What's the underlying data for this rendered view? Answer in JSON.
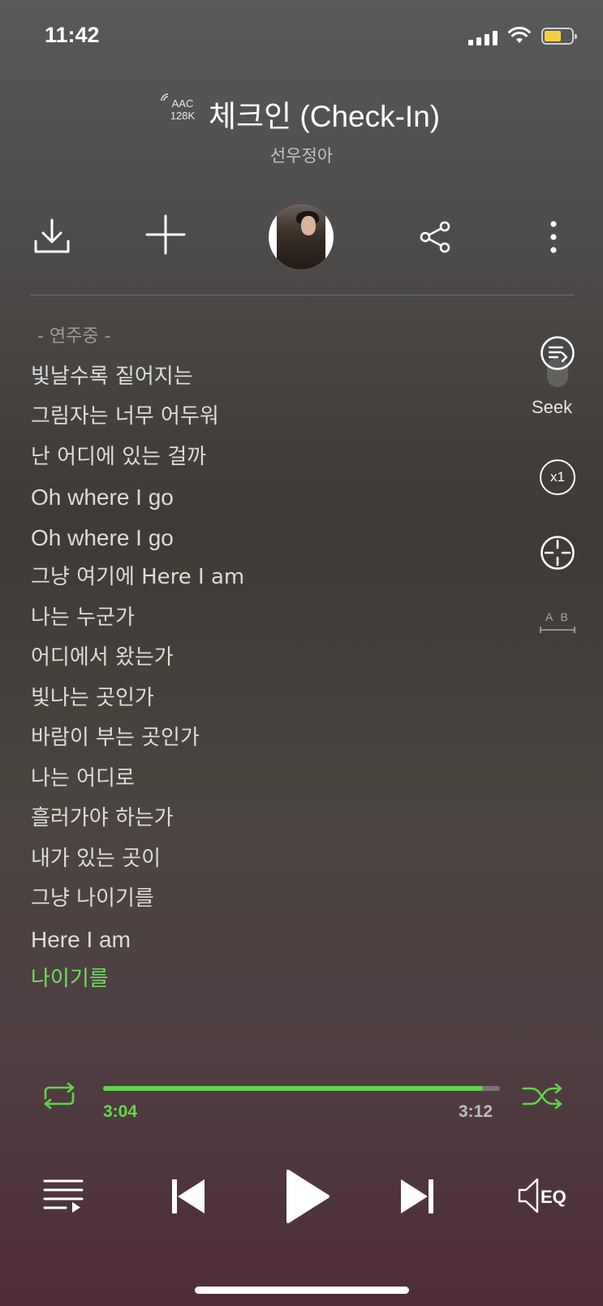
{
  "status_bar": {
    "time": "11:42"
  },
  "now_playing": {
    "codec_line1": "AAC",
    "codec_line2": "128K",
    "title": "체크인 (Check-In)",
    "artist": "선우정아"
  },
  "side_controls": {
    "seek_label": "Seek",
    "speed_label": "x1",
    "ab_label": "A B"
  },
  "lyrics": [
    {
      "text": "- 연주중 -",
      "state": "dim"
    },
    {
      "text": "빛날수록 짙어지는",
      "state": "normal"
    },
    {
      "text": "그림자는 너무 어두워",
      "state": "normal"
    },
    {
      "text": "난 어디에 있는 걸까",
      "state": "normal"
    },
    {
      "text": "Oh where I go",
      "state": "normal"
    },
    {
      "text": "Oh where I go",
      "state": "normal"
    },
    {
      "text": "그냥 여기에 Here I am",
      "state": "normal"
    },
    {
      "text": "나는 누군가",
      "state": "normal"
    },
    {
      "text": "어디에서 왔는가",
      "state": "normal"
    },
    {
      "text": "빛나는 곳인가",
      "state": "normal"
    },
    {
      "text": "바람이 부는 곳인가",
      "state": "normal"
    },
    {
      "text": "나는 어디로",
      "state": "normal"
    },
    {
      "text": "흘러가야 하는가",
      "state": "normal"
    },
    {
      "text": "내가 있는 곳이",
      "state": "normal"
    },
    {
      "text": "그냥 나이기를",
      "state": "normal"
    },
    {
      "text": "Here I am",
      "state": "normal"
    },
    {
      "text": "나이기를",
      "state": "active"
    }
  ],
  "playback": {
    "current_time": "3:04",
    "duration": "3:12",
    "progress_fraction": 0.958,
    "eq_label": "EQ"
  },
  "colors": {
    "accent": "#5fd34a",
    "battery": "#f4d03f"
  },
  "icons": [
    "download-icon",
    "add-icon",
    "share-icon",
    "more-icon",
    "lyrics-scroll-icon",
    "target-icon",
    "repeat-icon",
    "shuffle-icon",
    "playlist-icon",
    "previous-icon",
    "play-icon",
    "next-icon",
    "eq-icon",
    "wifi-icon",
    "battery-icon",
    "cellular-icon"
  ]
}
